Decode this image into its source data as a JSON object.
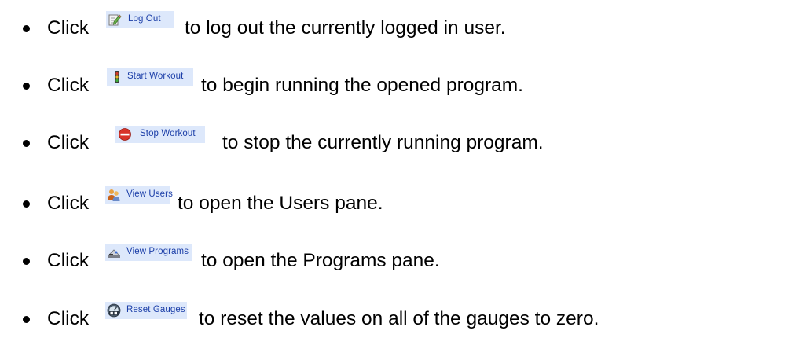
{
  "items": [
    {
      "click_word": "Click",
      "button": {
        "label": "Log Out",
        "icon": "log-out-icon"
      },
      "description": "to log out the currently logged in user."
    },
    {
      "click_word": "Click",
      "button": {
        "label": "Start Workout",
        "icon": "traffic-light-icon"
      },
      "description": "to begin running the opened program."
    },
    {
      "click_word": "Click",
      "button": {
        "label": "Stop Workout",
        "icon": "stop-sign-icon"
      },
      "description": "to stop the currently running program."
    },
    {
      "click_word": "Click",
      "button": {
        "label": "View Users",
        "icon": "users-icon"
      },
      "description": "to open the Users pane."
    },
    {
      "click_word": "Click",
      "button": {
        "label": "View Programs",
        "icon": "programs-icon"
      },
      "description": "to open the Programs pane."
    },
    {
      "click_word": "Click",
      "button": {
        "label": "Reset Gauges",
        "icon": "reset-gauge-icon"
      },
      "description": "to reset the values on all of the gauges to zero."
    }
  ],
  "colors": {
    "button_background": "#dde8fb",
    "button_text": "#1b3ea8",
    "body_text": "#000000"
  }
}
